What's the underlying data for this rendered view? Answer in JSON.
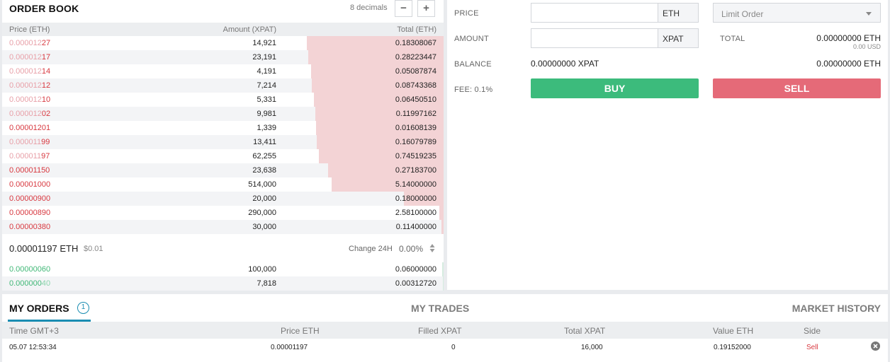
{
  "orderbook": {
    "title": "ORDER BOOK",
    "decimals_label": "8 decimals",
    "minus_label": "−",
    "plus_label": "+",
    "columns": {
      "price": "Price (ETH)",
      "amount": "Amount (XPAT)",
      "total": "Total (ETH)"
    },
    "asks": [
      {
        "price_prefix": "0.000012",
        "price_suffix": "27",
        "amount": "14,921",
        "total": "0.18308067",
        "depth": 0.31
      },
      {
        "price_prefix": "0.000012",
        "price_suffix": "17",
        "amount": "23,191",
        "total": "0.28223447",
        "depth": 0.307
      },
      {
        "price_prefix": "0.000012",
        "price_suffix": "14",
        "amount": "4,191",
        "total": "0.05087874",
        "depth": 0.3
      },
      {
        "price_prefix": "0.000012",
        "price_suffix": "12",
        "amount": "7,214",
        "total": "0.08743368",
        "depth": 0.298
      },
      {
        "price_prefix": "0.000012",
        "price_suffix": "10",
        "amount": "5,331",
        "total": "0.06450510",
        "depth": 0.294
      },
      {
        "price_prefix": "0.000012",
        "price_suffix": "02",
        "amount": "9,981",
        "total": "0.11997162",
        "depth": 0.29
      },
      {
        "price_prefix": "0.00001201",
        "price_suffix": "",
        "amount": "1,339",
        "total": "0.01608139",
        "depth": 0.289
      },
      {
        "price_prefix": "0.000011",
        "price_suffix": "99",
        "amount": "13,411",
        "total": "0.16079789",
        "depth": 0.288
      },
      {
        "price_prefix": "0.000011",
        "price_suffix": "97",
        "amount": "62,255",
        "total": "0.74519235",
        "depth": 0.283
      },
      {
        "price_prefix": "0.00001150",
        "price_suffix": "",
        "amount": "23,638",
        "total": "0.27183700",
        "depth": 0.261
      },
      {
        "price_prefix": "0.00001000",
        "price_suffix": "",
        "amount": "514,000",
        "total": "5.14000000",
        "depth": 0.254
      },
      {
        "price_prefix": "0.00000900",
        "price_suffix": "",
        "amount": "20,000",
        "total": "0.18000000",
        "depth": 0.09
      },
      {
        "price_prefix": "0.00000890",
        "price_suffix": "",
        "amount": "290,000",
        "total": "2.58100000",
        "depth": 0.01
      },
      {
        "price_prefix": "0.00000380",
        "price_suffix": "",
        "amount": "30,000",
        "total": "0.11400000",
        "depth": 0.005
      }
    ],
    "last_price": "0.00001197 ETH",
    "last_price_usd": "$0.01",
    "change_label": "Change 24H",
    "change_value": "0.00%",
    "bids": [
      {
        "price_prefix": "0.00000060",
        "price_suffix": "",
        "amount": "100,000",
        "total": "0.06000000",
        "depth": 0.003
      },
      {
        "price_prefix": "0.000000",
        "price_suffix": "40",
        "amount": "7,818",
        "total": "0.00312720",
        "depth": 0.002
      }
    ]
  },
  "trade_form": {
    "price_label": "PRICE",
    "price_unit": "ETH",
    "price_value": "",
    "order_type": "Limit Order",
    "amount_label": "AMOUNT",
    "amount_unit": "XPAT",
    "amount_value": "",
    "total_label": "TOTAL",
    "total_value": "0.00000000 ETH",
    "total_usd": "0.00 USD",
    "balance_label": "BALANCE",
    "balance_xpat": "0.00000000 XPAT",
    "balance_eth": "0.00000000 ETH",
    "fee_label": "FEE: 0.1%",
    "buy_label": "BUY",
    "sell_label": "SELL"
  },
  "orders": {
    "tabs": {
      "my_orders": "MY ORDERS",
      "my_orders_count": "1",
      "my_trades": "MY TRADES",
      "market_history": "MARKET HISTORY"
    },
    "columns": {
      "time": "Time GMT+3",
      "price": "Price ETH",
      "filled": "Filled XPAT",
      "total": "Total XPAT",
      "value": "Value ETH",
      "side": "Side"
    },
    "rows": [
      {
        "time": "05.07 12:53:34",
        "price": "0.00001197",
        "filled": "0",
        "total": "16,000",
        "value": "0.19152000",
        "side": "Sell"
      }
    ]
  },
  "colors": {
    "buy": "#3cbb7c",
    "sell": "#e56a78",
    "accent": "#1a8db2",
    "ask_text": "#d8383f",
    "bid_text": "#41b877"
  }
}
